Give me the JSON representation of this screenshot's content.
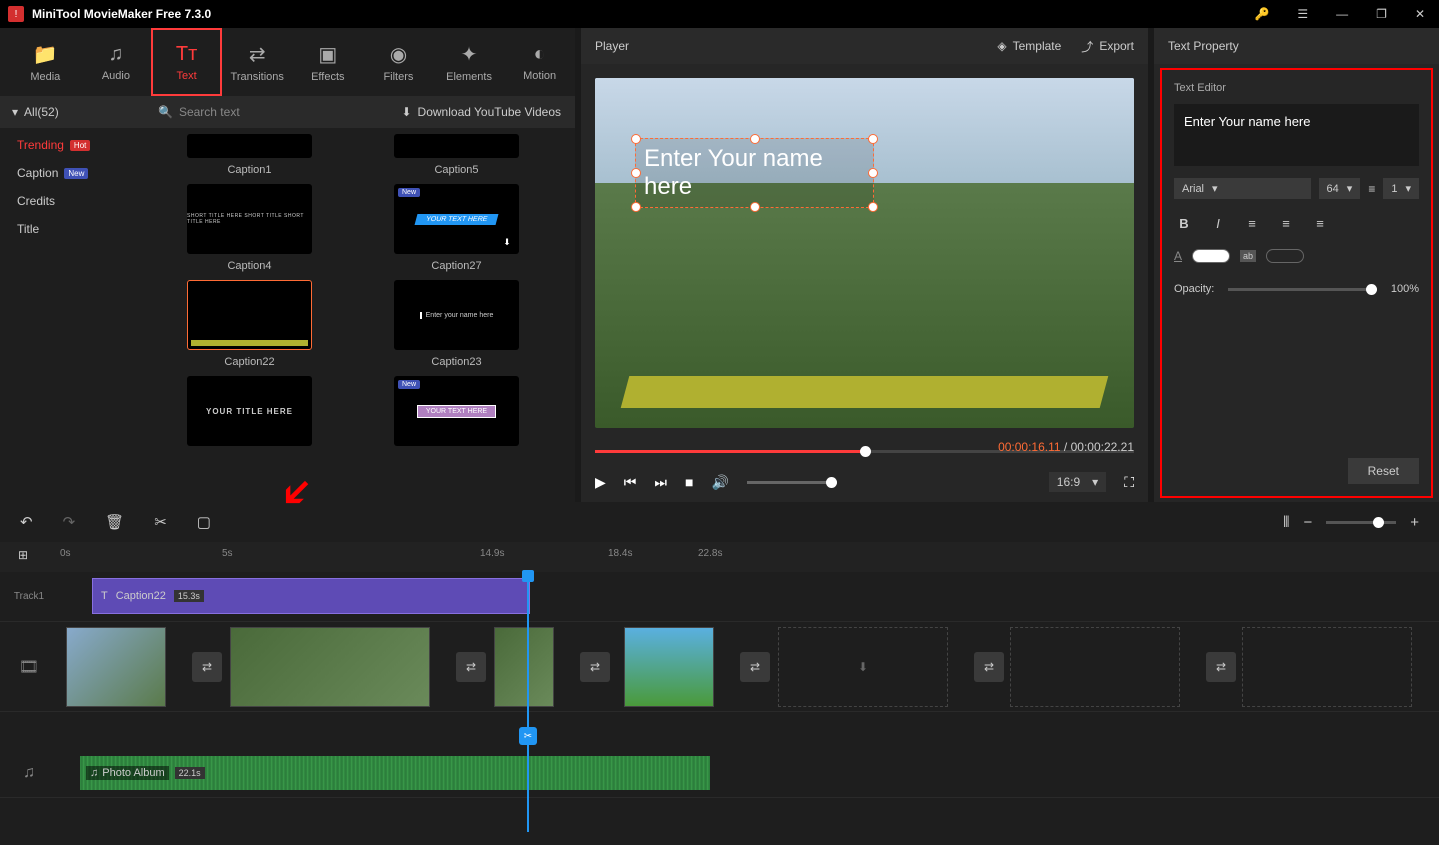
{
  "titlebar": {
    "title": "MiniTool MovieMaker Free 7.3.0"
  },
  "toolbar": {
    "items": [
      {
        "label": "Media"
      },
      {
        "label": "Audio"
      },
      {
        "label": "Text"
      },
      {
        "label": "Transitions"
      },
      {
        "label": "Effects"
      },
      {
        "label": "Filters"
      },
      {
        "label": "Elements"
      },
      {
        "label": "Motion"
      }
    ]
  },
  "library": {
    "all": "All(52)",
    "search_placeholder": "Search text",
    "download": "Download YouTube Videos",
    "categories": {
      "trending": "Trending",
      "trending_badge": "Hot",
      "caption": "Caption",
      "caption_badge": "New",
      "credits": "Credits",
      "title": "Title"
    },
    "thumbs": {
      "c1": "Caption1",
      "c5": "Caption5",
      "c4": "Caption4",
      "c27": "Caption27",
      "c22": "Caption22",
      "c23": "Caption23",
      "ph_title": "YOUR TITLE HERE",
      "ph_text": "YOUR TEXT HERE",
      "ph_enter": "Enter your name here",
      "new": "New"
    }
  },
  "player": {
    "title": "Player",
    "template": "Template",
    "export": "Export",
    "overlay_text": "Enter Your name here",
    "time_current": "00:00:16.11",
    "time_sep": " / ",
    "time_total": "00:00:22.21",
    "aspect": "16:9"
  },
  "text_property": {
    "header": "Text Property",
    "editor": "Text Editor",
    "text_value": "Enter Your name here",
    "font": "Arial",
    "size": "64",
    "line": "1",
    "opacity_label": "Opacity:",
    "opacity_value": "100%",
    "reset": "Reset"
  },
  "timeline": {
    "marks": {
      "m0": "0s",
      "m1": "5s",
      "m2": "14.9s",
      "m3": "18.4s",
      "m4": "22.8s"
    },
    "track1": "Track1",
    "clip_text": {
      "name": "Caption22",
      "dur": "15.3s"
    },
    "audio": {
      "name": "Photo Album",
      "dur": "22.1s"
    }
  }
}
